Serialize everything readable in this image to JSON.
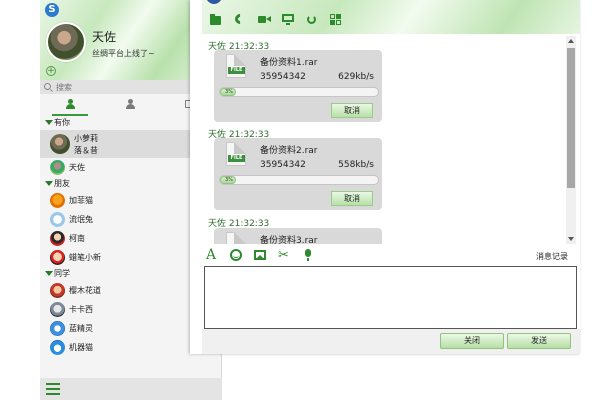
{
  "profile": {
    "name": "天佐",
    "signature": "丝绸平台上线了~"
  },
  "search": {
    "placeholder": "搜索"
  },
  "groups": [
    {
      "name": "有你",
      "contacts": [
        {
          "name": "小萝莉",
          "signature": "落＆昔"
        },
        {
          "name": "天佐"
        }
      ]
    },
    {
      "name": "朋友",
      "contacts": [
        {
          "name": "加菲猫"
        },
        {
          "name": "流氓兔"
        },
        {
          "name": "柯南"
        },
        {
          "name": "蜡笔小新"
        }
      ]
    },
    {
      "name": "同学",
      "contacts": [
        {
          "name": "樱木花道"
        },
        {
          "name": "卡卡西"
        },
        {
          "name": "蓝精灵"
        },
        {
          "name": "机器猫"
        }
      ]
    }
  ],
  "messages": [
    {
      "sender": "天佐",
      "time": "21:32:33",
      "sender_time": "天佐 21:32:33",
      "file_name": "备份资料1.rar",
      "file_size": "35954342",
      "speed": "629kb/s",
      "progress_percent": 3,
      "progress_label": "3%",
      "cancel_label": "取消"
    },
    {
      "sender": "天佐",
      "time": "21:32:33",
      "sender_time": "天佐 21:32:33",
      "file_name": "备份资料2.rar",
      "file_size": "35954342",
      "speed": "558kb/s",
      "progress_percent": 3,
      "progress_label": "3%",
      "cancel_label": "取消"
    },
    {
      "sender": "天佐",
      "time": "21:32:33",
      "sender_time": "天佐 21:32:33",
      "file_name": "备份资料3.rar"
    }
  ],
  "file_icon_tag": "FILE",
  "input_toolbar": {
    "font_icon": "A",
    "history_label": "消息记录"
  },
  "footer": {
    "close_label": "关闭",
    "send_label": "发送"
  },
  "colors": {
    "accent": "#2d8a2d",
    "header_green": "#c7e8bd",
    "button_green": "#b6dea5"
  },
  "icons": {
    "chat_header": [
      "file-transfer-icon",
      "phone-icon",
      "video-icon",
      "screen-share-icon",
      "refresh-icon",
      "apps-icon"
    ],
    "input_toolbar": [
      "font-icon",
      "emoji-icon",
      "image-icon",
      "scissors-icon",
      "microphone-icon"
    ]
  }
}
